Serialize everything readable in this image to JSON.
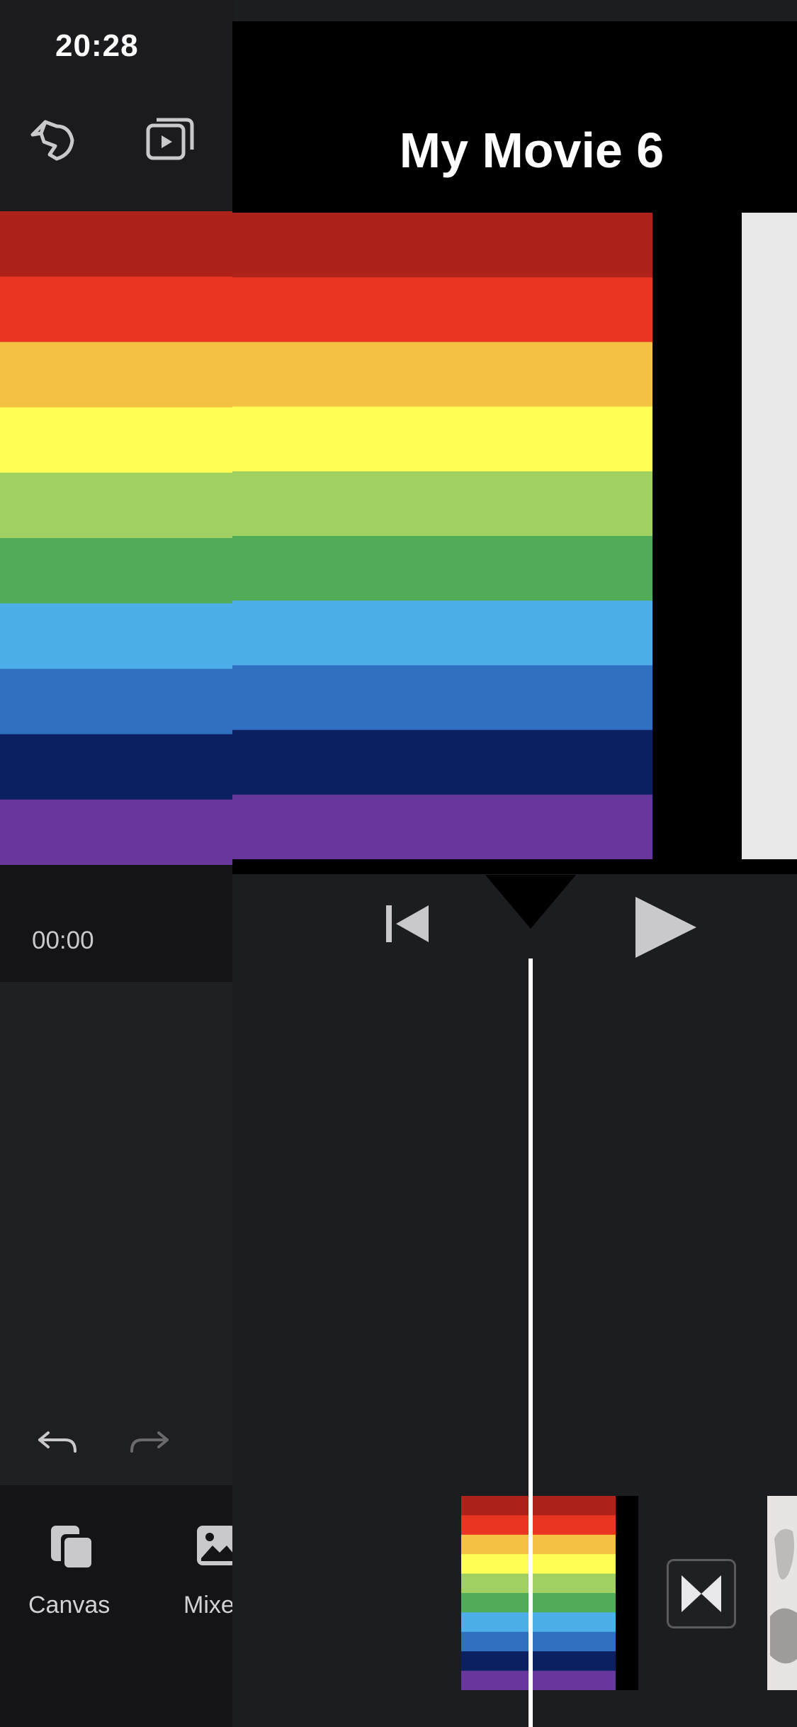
{
  "status_bar": {
    "time": "20:28"
  },
  "project": {
    "title": "My Movie 6"
  },
  "timeline": {
    "current_time": "00:00"
  },
  "bottom_tools": [
    {
      "label": "Canvas",
      "icon": "canvas-icon"
    },
    {
      "label": "Mixe",
      "icon": "mixer-icon"
    }
  ],
  "rainbow_colors": [
    "#ae2319",
    "#eb3523",
    "#f5c142",
    "#fefe55",
    "#a0cf62",
    "#50ac59",
    "#4daeea",
    "#3070c0",
    "#0b2060",
    "#67379b"
  ],
  "icons": [
    "anime-avatar-icon",
    "fullscreen-play-icon",
    "skip-to-start-icon",
    "play-icon",
    "playhead-marker-icon",
    "undo-icon",
    "redo-icon",
    "transition-icon"
  ],
  "colors": {
    "background": "#1c1d20",
    "panel": "#141416",
    "accent": "#ffffff"
  }
}
